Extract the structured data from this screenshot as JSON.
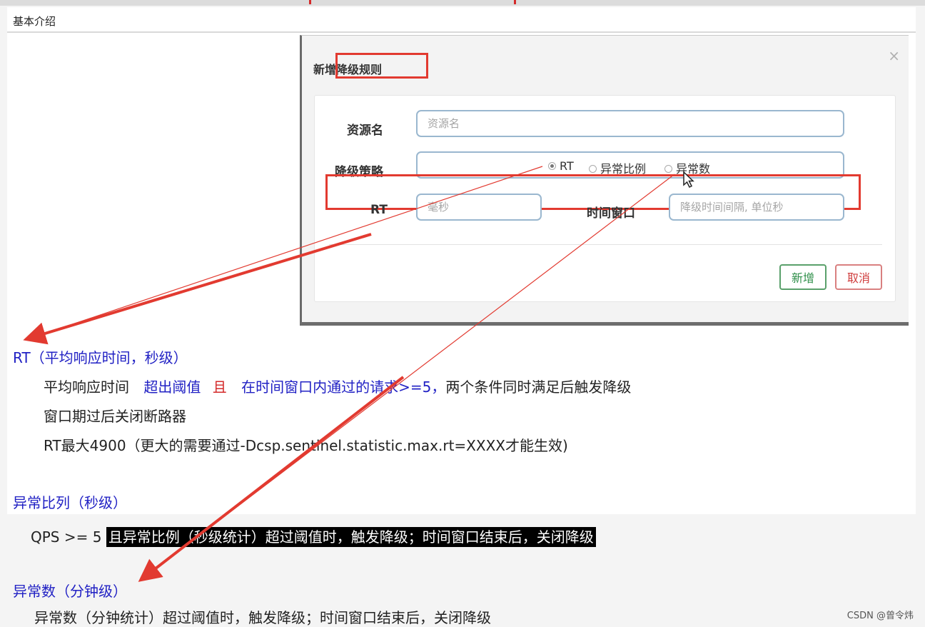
{
  "header": {
    "title": "基本介绍"
  },
  "modal": {
    "title": "新增降级规则",
    "close_symbol": "×",
    "resource_label": "资源名",
    "resource_placeholder": "资源名",
    "strategy_label": "降级策略",
    "strategy_options": [
      {
        "label": "RT",
        "checked": true
      },
      {
        "label": "异常比例",
        "checked": false
      },
      {
        "label": "异常数",
        "checked": false
      }
    ],
    "rt_label": "RT",
    "rt_placeholder": "毫秒",
    "window_label": "时间窗口",
    "window_placeholder": "降级时间间隔, 单位秒",
    "add_button": "新增",
    "cancel_button": "取消"
  },
  "sections": {
    "rt": {
      "heading": "RT（平均响应时间，秒级）",
      "line1_a": "平均响应时间",
      "line1_b": "超出阈值",
      "line1_c": "且",
      "line1_d": "在时间窗口内通过的请求>=5，",
      "line1_e": "两个条件同时满足后触发降级",
      "line2": "窗口期过后关闭断路器",
      "line3": "RT最大4900（更大的需要通过-Dcsp.sentinel.statistic.max.rt=XXXX才能生效)"
    },
    "ratio": {
      "heading": "异常比列（秒级）",
      "line_a": "QPS >= 5",
      "line_b": "且异常比例（秒级统计）超过阈值时，触发降级；时间窗口结束后，关闭降级"
    },
    "count": {
      "heading": "异常数（分钟级）",
      "line": "异常数（分钟统计）超过阈值时，触发降级；时间窗口结束后，关闭降级"
    }
  },
  "watermark": "CSDN @曾令炜",
  "colors": {
    "annotation_red": "#e23a30",
    "heading_blue": "#2121c4",
    "highlight_black": "#000000"
  },
  "icons": [
    "mouse-cursor-icon",
    "close-icon"
  ]
}
